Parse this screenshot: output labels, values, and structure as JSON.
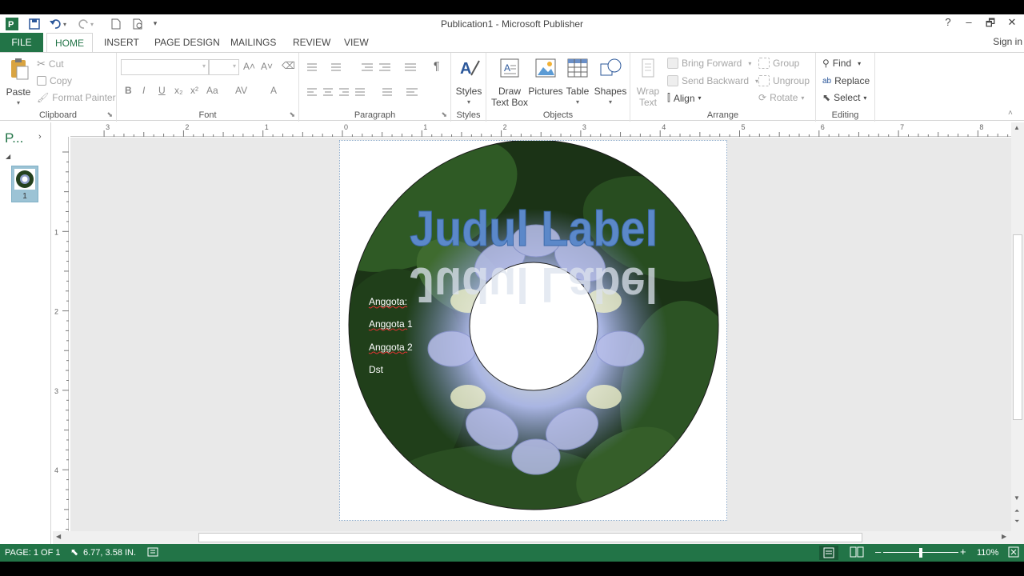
{
  "titlebar": {
    "title": "Publication1 - Microsoft Publisher",
    "help": "?",
    "minimize": "–",
    "restore": "🗗",
    "close": "✕"
  },
  "tabs": {
    "file": "FILE",
    "home": "HOME",
    "insert": "INSERT",
    "page_design": "PAGE DESIGN",
    "mailings": "MAILINGS",
    "review": "REVIEW",
    "view": "VIEW",
    "sign_in": "Sign in"
  },
  "clipboard": {
    "paste": "Paste",
    "cut": "Cut",
    "copy": "Copy",
    "format_painter": "Format Painter",
    "label": "Clipboard"
  },
  "font": {
    "label": "Font",
    "bold": "B",
    "italic": "I",
    "underline": "U",
    "subscript": "x₂",
    "superscript": "x²",
    "change_case": "Aa",
    "spacing": "AV",
    "grow": "A˄",
    "shrink": "A˅",
    "color": "A"
  },
  "paragraph": {
    "label": "Paragraph",
    "pilcrow": "¶"
  },
  "styles": {
    "button": "Styles",
    "label": "Styles"
  },
  "objects": {
    "draw_text_box_1": "Draw",
    "draw_text_box_2": "Text Box",
    "pictures": "Pictures",
    "table": "Table",
    "shapes": "Shapes",
    "label": "Objects"
  },
  "arrange": {
    "wrap_1": "Wrap",
    "wrap_2": "Text",
    "bring_forward": "Bring Forward",
    "send_backward": "Send Backward",
    "align": "Align",
    "group": "Group",
    "ungroup": "Ungroup",
    "rotate": "Rotate",
    "label": "Arrange"
  },
  "editing": {
    "find": "Find",
    "replace": "Replace",
    "select": "Select",
    "label": "Editing"
  },
  "pane": {
    "title": "P...",
    "page_number": "1"
  },
  "ruler": {
    "h_labels": [
      "3",
      "2",
      "1",
      "0",
      "1",
      "2",
      "3",
      "4",
      "5",
      "6",
      "7",
      "8"
    ],
    "v_labels": [
      "1",
      "2",
      "3",
      "4"
    ]
  },
  "label": {
    "title": "Judul Label",
    "members": [
      "Anggota:",
      "Anggota 1",
      "Anggota 2",
      "Dst"
    ]
  },
  "status": {
    "page": "PAGE: 1 OF 1",
    "position": "6.77, 3.58 IN.",
    "zoom": "110%"
  },
  "colors": {
    "accent": "#227447",
    "title_text": "#5b88c9"
  }
}
